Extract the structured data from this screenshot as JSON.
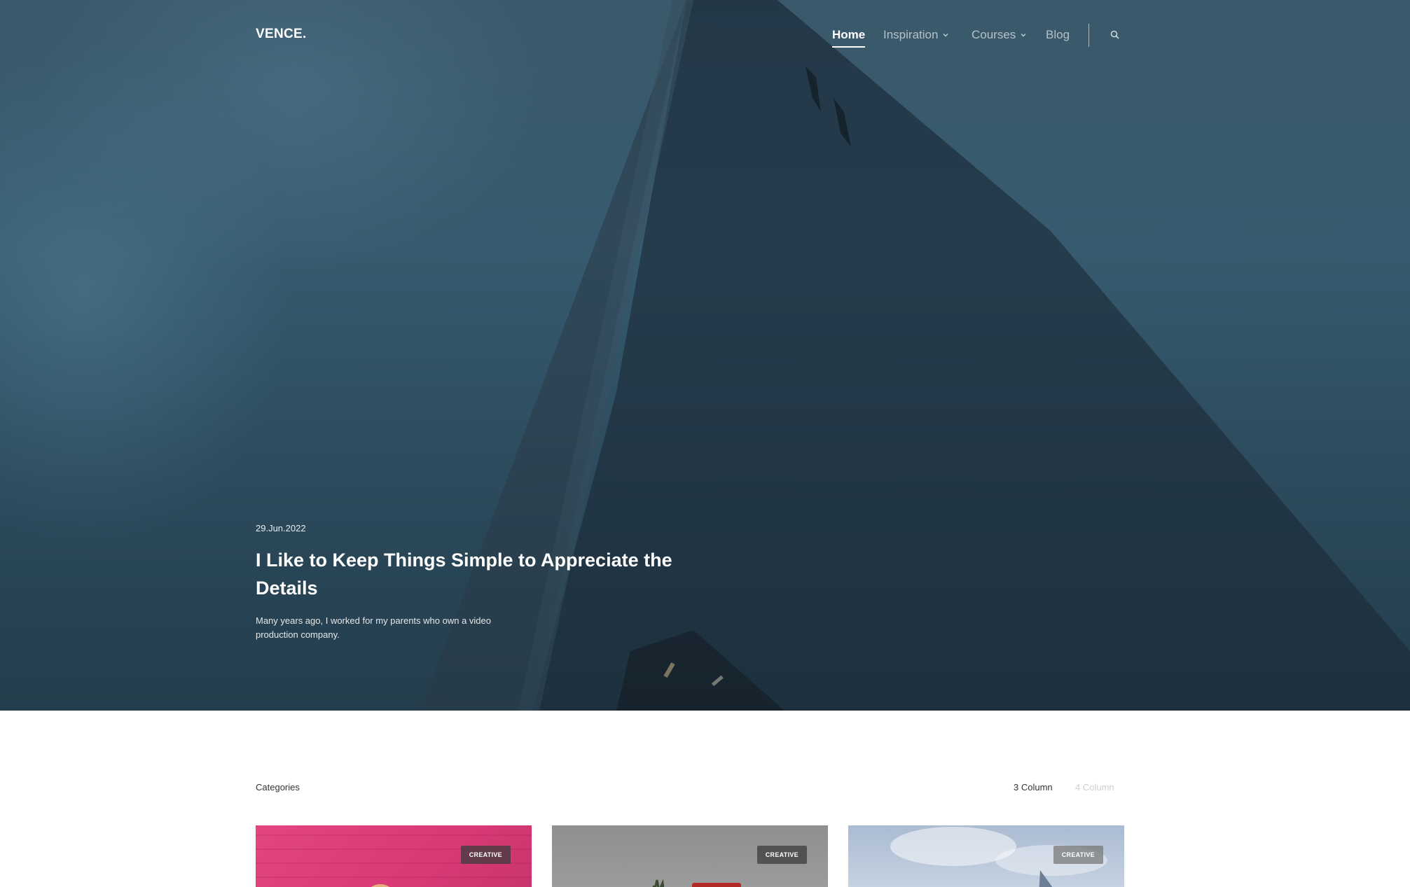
{
  "brand": {
    "logo": "VENCE."
  },
  "nav": {
    "items": [
      {
        "label": "Home",
        "active": true,
        "dropdown": false
      },
      {
        "label": "Inspiration",
        "active": false,
        "dropdown": true
      },
      {
        "label": "Courses",
        "active": false,
        "dropdown": true
      },
      {
        "label": "Blog",
        "active": false,
        "dropdown": false
      }
    ],
    "search_icon": "search-icon"
  },
  "hero": {
    "date": "29.Jun.2022",
    "title": "I Like to Keep Things Simple to Appreciate the Details",
    "excerpt": "Many years ago, I worked for my parents who own a video production company."
  },
  "listing": {
    "categories_label": "Categories",
    "column_options": [
      "3 Column",
      "4 Column"
    ],
    "active_column": "3 Column"
  },
  "cards": [
    {
      "badge": "CREATIVE",
      "image_color": "#e2457f"
    },
    {
      "badge": "CREATIVE",
      "image_color": "#9a9a9a"
    },
    {
      "badge": "CREATIVE",
      "image_color": "#b7c6d9"
    }
  ],
  "colors": {
    "text": "#222222",
    "muted": "#cfcfcf",
    "hero_bg": "#34586c"
  }
}
